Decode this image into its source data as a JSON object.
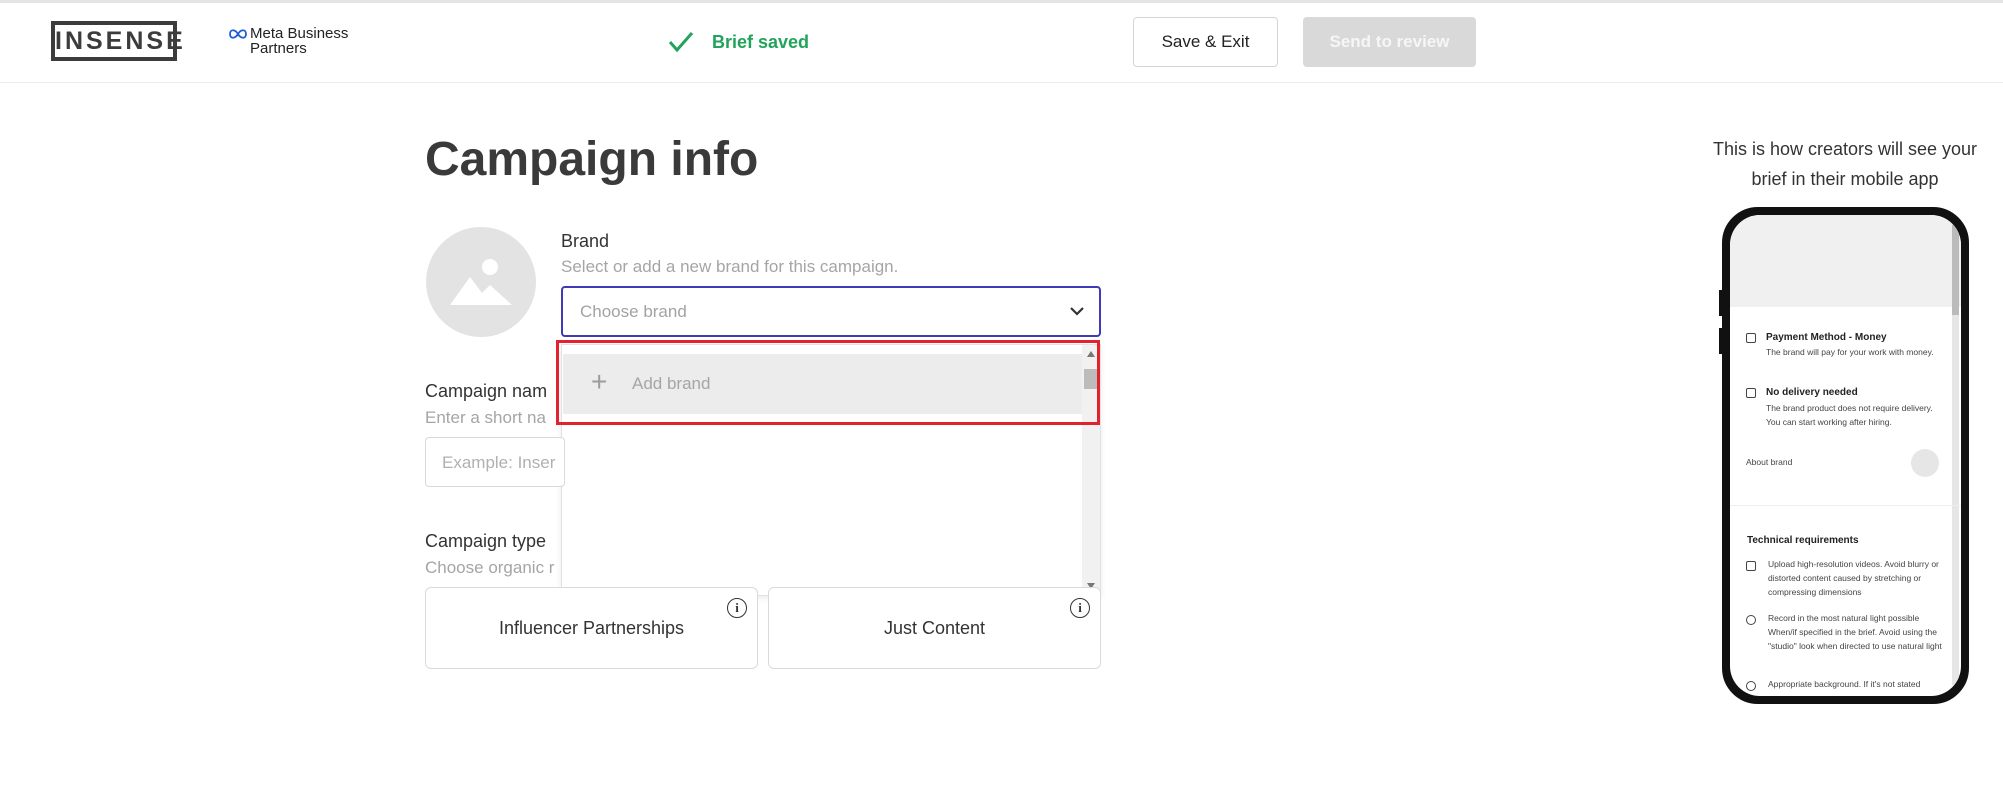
{
  "header": {
    "logo_text": "INSENSE",
    "partner_line1": "Meta Business",
    "partner_line2": "Partners",
    "status_text": "Brief saved",
    "save_exit_label": "Save & Exit",
    "send_review_label": "Send to review"
  },
  "main": {
    "title": "Campaign info",
    "brand": {
      "label": "Brand",
      "hint": "Select or add a new brand for this campaign.",
      "placeholder": "Choose brand",
      "dropdown_items": [
        {
          "icon": "+",
          "label": "Add brand"
        }
      ]
    },
    "campaign_name": {
      "label": "Campaign nam",
      "hint": "Enter a short na",
      "placeholder": "Example: Inser"
    },
    "campaign_type": {
      "label": "Campaign type",
      "hint": "Choose organic r",
      "options": [
        {
          "label": "Influencer Partnerships",
          "info": "i"
        },
        {
          "label": "Just Content",
          "info": "i"
        }
      ]
    }
  },
  "preview": {
    "caption": "This is how creators will see your brief in their mobile app",
    "items": [
      {
        "title": "Payment Method - Money",
        "text": "The brand will pay for your work with money."
      },
      {
        "title": "No delivery needed",
        "text": "The brand product does not require delivery. You can start working after hiring."
      }
    ],
    "about_brand": "About brand",
    "tech_heading": "Technical requirements",
    "tech_items": [
      "Upload high-resolution videos. Avoid blurry or distorted content caused by stretching or compressing dimensions",
      "Record in the most natural light possible When/if specified in the brief. Avoid using the \"studio\" look when directed to use natural light",
      "Appropriate background. If it's not stated"
    ]
  },
  "colors": {
    "accent": "#3f3ab8",
    "success": "#21a35b",
    "highlight": "#e0232f"
  }
}
